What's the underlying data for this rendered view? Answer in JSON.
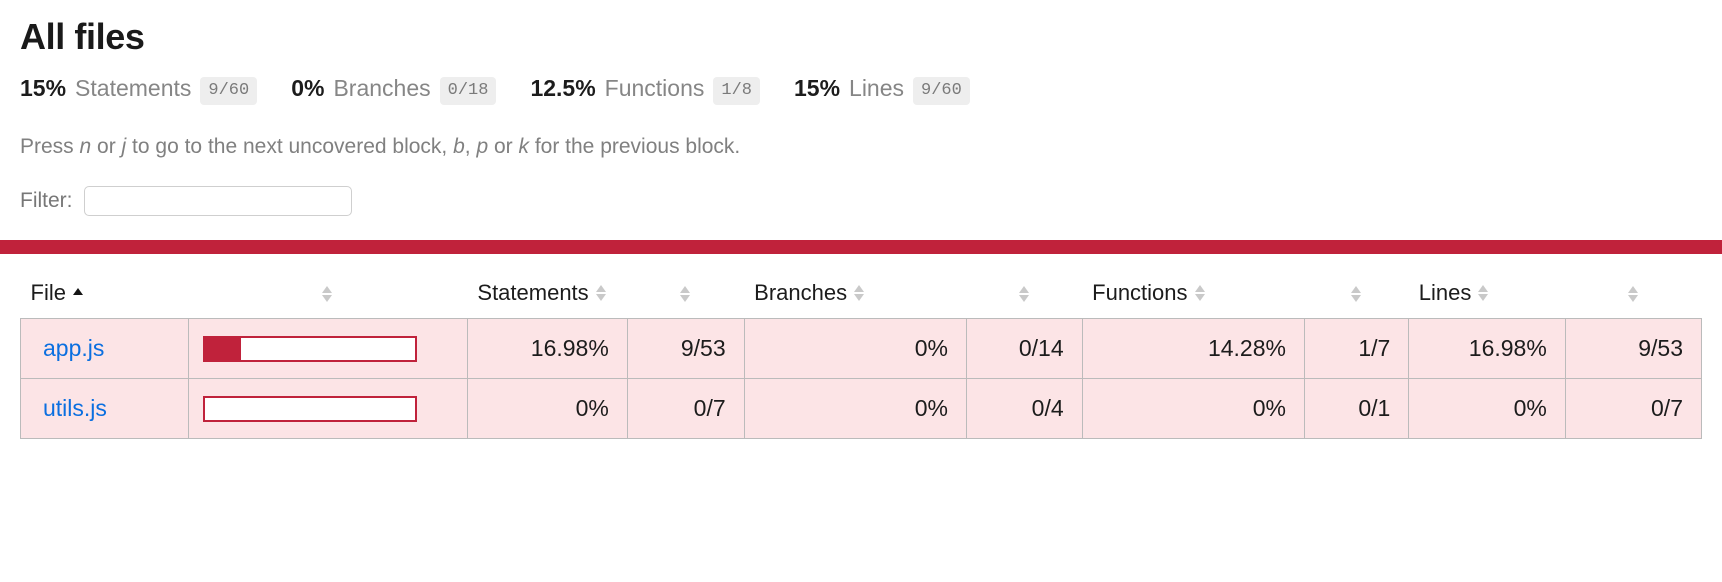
{
  "header": {
    "title": "All files",
    "summary": [
      {
        "pct": "15%",
        "label": "Statements",
        "fraction": "9/60"
      },
      {
        "pct": "0%",
        "label": "Branches",
        "fraction": "0/18"
      },
      {
        "pct": "12.5%",
        "label": "Functions",
        "fraction": "1/8"
      },
      {
        "pct": "15%",
        "label": "Lines",
        "fraction": "9/60"
      }
    ],
    "hint": {
      "p1": "Press ",
      "k1": "n",
      "p2": " or ",
      "k2": "j",
      "p3": " to go to the next uncovered block, ",
      "k3": "b",
      "p4": ", ",
      "k4": "p",
      "p5": " or ",
      "k5": "k",
      "p6": " for the previous block."
    }
  },
  "filter": {
    "label": "Filter:",
    "value": "",
    "placeholder": ""
  },
  "status": {
    "color": "#c0223b"
  },
  "table": {
    "columns": [
      {
        "label": "File",
        "sort": "asc"
      },
      {
        "label": "",
        "sort": "none"
      },
      {
        "label": "Statements",
        "sort": "none"
      },
      {
        "label": "",
        "sort": "none"
      },
      {
        "label": "Branches",
        "sort": "none"
      },
      {
        "label": "",
        "sort": "none"
      },
      {
        "label": "Functions",
        "sort": "none"
      },
      {
        "label": "",
        "sort": "none"
      },
      {
        "label": "Lines",
        "sort": "none"
      },
      {
        "label": "",
        "sort": "none"
      }
    ],
    "rows": [
      {
        "file": "app.js",
        "bar_pct": 16.98,
        "statements_pct": "16.98%",
        "statements_abs": "9/53",
        "branches_pct": "0%",
        "branches_abs": "0/14",
        "functions_pct": "14.28%",
        "functions_abs": "1/7",
        "lines_pct": "16.98%",
        "lines_abs": "9/53"
      },
      {
        "file": "utils.js",
        "bar_pct": 0,
        "statements_pct": "0%",
        "statements_abs": "0/7",
        "branches_pct": "0%",
        "branches_abs": "0/4",
        "functions_pct": "0%",
        "functions_abs": "0/1",
        "lines_pct": "0%",
        "lines_abs": "0/7"
      }
    ]
  }
}
